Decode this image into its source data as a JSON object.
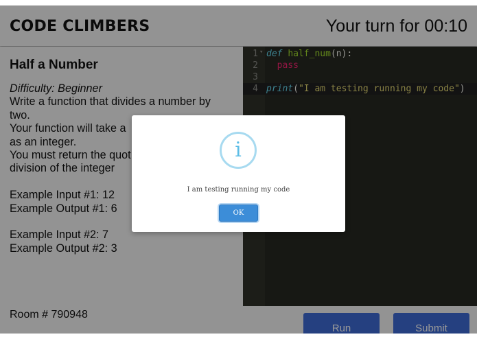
{
  "header": {
    "brand": "CODE CLIMBERS",
    "timer": "Your turn for 00:10"
  },
  "problem": {
    "title": "Half a Number",
    "difficulty": "Difficulty: Beginner",
    "lines": [
      "Write a function that divides a number by",
      "two.",
      "Your function will take a",
      "as an integer.",
      "You must return the quot",
      "division of the integer"
    ],
    "examples": [
      "Example Input #1: 12",
      "Example Output #1: 6",
      "Example Input #2: 7",
      "Example Output #2: 3"
    ]
  },
  "editor": {
    "line_numbers": [
      "1",
      "2",
      "3",
      "4"
    ],
    "fold_marker": "▾",
    "code": {
      "l1_kw": "def",
      "l1_name": "half_num",
      "l1_rest": "(n):",
      "l2_kw": "pass",
      "l4_fn": "print",
      "l4_str": "\"I am testing running my code\"",
      "open_paren": "(",
      "close_paren": ")"
    }
  },
  "footer": {
    "room": "Room # 790948",
    "run_label": "Run",
    "submit_label": "Submit"
  },
  "modal": {
    "icon_glyph": "i",
    "message": "I am testing running my code",
    "ok_label": "OK"
  },
  "colors": {
    "accent": "#3f6bd6",
    "ok": "#3c8dd8",
    "editor_bg": "#272822",
    "info": "#5dbde6"
  }
}
